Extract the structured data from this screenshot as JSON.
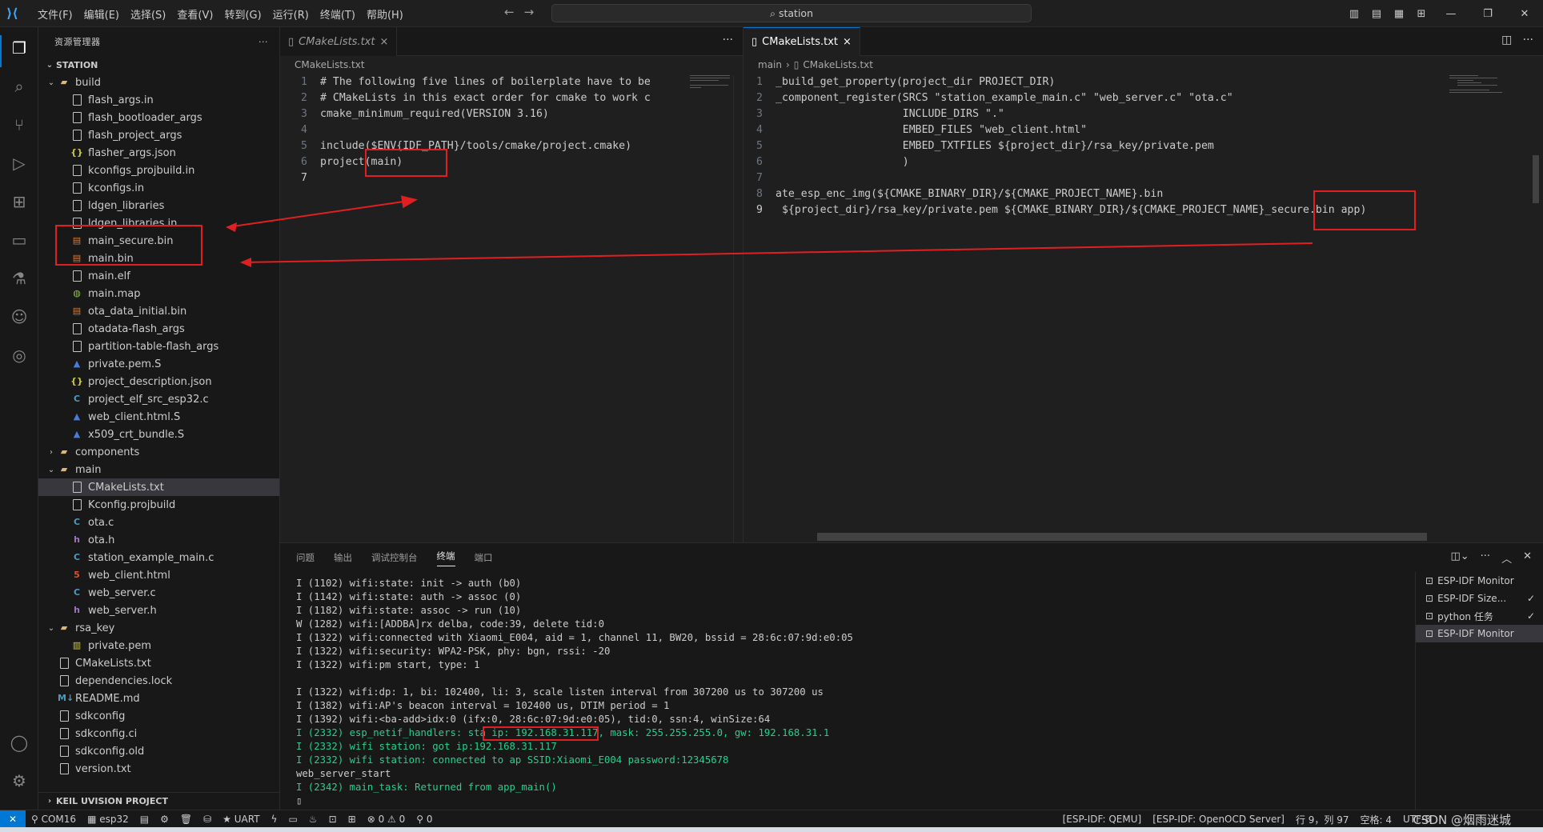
{
  "titlebar": {
    "menu": [
      "文件(F)",
      "编辑(E)",
      "选择(S)",
      "查看(V)",
      "转到(G)",
      "运行(R)",
      "终端(T)",
      "帮助(H)"
    ],
    "search": "station"
  },
  "sidebar": {
    "title": "资源管理器",
    "more": "···",
    "section": "STATION",
    "bottom_section": "KEIL UVISION PROJECT",
    "tree": [
      {
        "label": "build",
        "type": "folder-open",
        "indent": 1
      },
      {
        "label": "flash_args.in",
        "type": "file",
        "indent": 2
      },
      {
        "label": "flash_bootloader_args",
        "type": "file",
        "indent": 2
      },
      {
        "label": "flash_project_args",
        "type": "file",
        "indent": 2
      },
      {
        "label": "flasher_args.json",
        "type": "json",
        "indent": 2
      },
      {
        "label": "kconfigs_projbuild.in",
        "type": "file",
        "indent": 2
      },
      {
        "label": "kconfigs.in",
        "type": "file",
        "indent": 2
      },
      {
        "label": "ldgen_libraries",
        "type": "file",
        "indent": 2
      },
      {
        "label": "ldgen_libraries.in",
        "type": "file",
        "indent": 2
      },
      {
        "label": "main_secure.bin",
        "type": "bin",
        "indent": 2
      },
      {
        "label": "main.bin",
        "type": "bin",
        "indent": 2
      },
      {
        "label": "main.elf",
        "type": "file",
        "indent": 2
      },
      {
        "label": "main.map",
        "type": "map",
        "indent": 2
      },
      {
        "label": "ota_data_initial.bin",
        "type": "bin",
        "indent": 2
      },
      {
        "label": "otadata-flash_args",
        "type": "file",
        "indent": 2
      },
      {
        "label": "partition-table-flash_args",
        "type": "file",
        "indent": 2
      },
      {
        "label": "private.pem.S",
        "type": "s",
        "indent": 2
      },
      {
        "label": "project_description.json",
        "type": "json",
        "indent": 2
      },
      {
        "label": "project_elf_src_esp32.c",
        "type": "c",
        "indent": 2
      },
      {
        "label": "web_client.html.S",
        "type": "s",
        "indent": 2
      },
      {
        "label": "x509_crt_bundle.S",
        "type": "s",
        "indent": 2
      },
      {
        "label": "components",
        "type": "folder-closed",
        "indent": 1
      },
      {
        "label": "main",
        "type": "folder-open",
        "indent": 1
      },
      {
        "label": "CMakeLists.txt",
        "type": "file",
        "indent": 2,
        "selected": true
      },
      {
        "label": "Kconfig.projbuild",
        "type": "file",
        "indent": 2
      },
      {
        "label": "ota.c",
        "type": "c",
        "indent": 2
      },
      {
        "label": "ota.h",
        "type": "h",
        "indent": 2
      },
      {
        "label": "station_example_main.c",
        "type": "c",
        "indent": 2
      },
      {
        "label": "web_client.html",
        "type": "html",
        "indent": 2
      },
      {
        "label": "web_server.c",
        "type": "c",
        "indent": 2
      },
      {
        "label": "web_server.h",
        "type": "h",
        "indent": 2
      },
      {
        "label": "rsa_key",
        "type": "folder-open",
        "indent": 1
      },
      {
        "label": "private.pem",
        "type": "pem",
        "indent": 2
      },
      {
        "label": "CMakeLists.txt",
        "type": "file",
        "indent": 1
      },
      {
        "label": "dependencies.lock",
        "type": "file",
        "indent": 1
      },
      {
        "label": "README.md",
        "type": "md",
        "indent": 1
      },
      {
        "label": "sdkconfig",
        "type": "file",
        "indent": 1
      },
      {
        "label": "sdkconfig.ci",
        "type": "file",
        "indent": 1
      },
      {
        "label": "sdkconfig.old",
        "type": "file",
        "indent": 1
      },
      {
        "label": "version.txt",
        "type": "file",
        "indent": 1
      }
    ]
  },
  "editor_left": {
    "tab": "CMakeLists.txt",
    "tab_close": "×",
    "breadcrumb_file": "CMakeLists.txt",
    "lines": [
      {
        "n": "1",
        "text": "# The following five lines of boilerplate have to be"
      },
      {
        "n": "2",
        "text": "# CMakeLists in this exact order for cmake to work c"
      },
      {
        "n": "3",
        "text": "cmake_minimum_required(VERSION 3.16)"
      },
      {
        "n": "4",
        "text": ""
      },
      {
        "n": "5",
        "text": "include($ENV{IDF_PATH}/tools/cmake/project.cmake)"
      },
      {
        "n": "6",
        "text": "project(main)"
      },
      {
        "n": "7",
        "text": ""
      }
    ]
  },
  "editor_right": {
    "tab": "CMakeLists.txt",
    "tab_close": "×",
    "breadcrumb_folder": "main",
    "breadcrumb_file": "CMakeLists.txt",
    "lines": [
      {
        "n": "1",
        "text": "_build_get_property(project_dir PROJECT_DIR)"
      },
      {
        "n": "2",
        "text": "_component_register(SRCS \"station_example_main.c\" \"web_server.c\" \"ota.c\""
      },
      {
        "n": "3",
        "text": "                    INCLUDE_DIRS \".\""
      },
      {
        "n": "4",
        "text": "                    EMBED_FILES \"web_client.html\""
      },
      {
        "n": "5",
        "text": "                    EMBED_TXTFILES ${project_dir}/rsa_key/private.pem"
      },
      {
        "n": "6",
        "text": "                    )"
      },
      {
        "n": "7",
        "text": ""
      },
      {
        "n": "8",
        "text": "ate_esp_enc_img(${CMAKE_BINARY_DIR}/${CMAKE_PROJECT_NAME}.bin"
      },
      {
        "n": "9",
        "text": " ${project_dir}/rsa_key/private.pem ${CMAKE_BINARY_DIR}/${CMAKE_PROJECT_NAME}_secure.bin app)"
      }
    ]
  },
  "panel": {
    "tabs": [
      "问题",
      "输出",
      "调试控制台",
      "终端",
      "端口"
    ],
    "active_tab": "终端",
    "terminal_lines": [
      {
        "t": "I (1102) wifi:state: init -> auth (b0)",
        "g": false
      },
      {
        "t": "I (1142) wifi:state: auth -> assoc (0)",
        "g": false
      },
      {
        "t": "I (1182) wifi:state: assoc -> run (10)",
        "g": false
      },
      {
        "t": "W (1282) wifi:[ADDBA]rx delba, code:39, delete tid:0",
        "g": false
      },
      {
        "t": "I (1322) wifi:connected with Xiaomi_E004, aid = 1, channel 11, BW20, bssid = 28:6c:07:9d:e0:05",
        "g": false
      },
      {
        "t": "I (1322) wifi:security: WPA2-PSK, phy: bgn, rssi: -20",
        "g": false
      },
      {
        "t": "I (1322) wifi:pm start, type: 1",
        "g": false
      },
      {
        "t": "",
        "g": false
      },
      {
        "t": "I (1322) wifi:dp: 1, bi: 102400, li: 3, scale listen interval from 307200 us to 307200 us",
        "g": false
      },
      {
        "t": "I (1382) wifi:AP's beacon interval = 102400 us, DTIM period = 1",
        "g": false
      },
      {
        "t": "I (1392) wifi:<ba-add>idx:0 (ifx:0, 28:6c:07:9d:e0:05), tid:0, ssn:4, winSize:64",
        "g": false
      },
      {
        "t": "I (2332) esp_netif_handlers: sta ip: 192.168.31.117, mask: 255.255.255.0, gw: 192.168.31.1",
        "g": true
      },
      {
        "t": "I (2332) wifi station: got ip:192.168.31.117",
        "g": true
      },
      {
        "t": "I (2332) wifi station: connected to ap SSID:Xiaomi_E004 password:12345678",
        "g": true
      },
      {
        "t": "web_server_start",
        "g": false
      },
      {
        "t": "I (2342) main_task: Returned from app_main()",
        "g": true
      },
      {
        "t": "▯",
        "g": false
      }
    ],
    "terminals": [
      {
        "label": "ESP-IDF Monitor",
        "check": ""
      },
      {
        "label": "ESP-IDF Size...",
        "check": "✓"
      },
      {
        "label": "python 任务",
        "check": "✓"
      },
      {
        "label": "ESP-IDF Monitor",
        "check": "",
        "selected": true
      }
    ]
  },
  "statusbar": {
    "left": [
      "COM16",
      "esp32",
      "",
      "",
      "",
      "",
      "UART",
      "",
      "",
      "",
      "",
      "⊗ 0 ⚠ 0",
      "📶 0"
    ],
    "com": "COM16",
    "target": "esp32",
    "uart": "UART",
    "problems": "0 ⚠ 0",
    "ports": "0",
    "right": [
      "[ESP-IDF: QEMU]",
      "[ESP-IDF: OpenOCD Server]",
      "行 9，列 97",
      "空格: 4",
      "UTF-8"
    ]
  },
  "watermark": "CSDN @烟雨迷城",
  "colors": {
    "accent": "#0078d4",
    "annotation": "#e02020",
    "terminal_green": "#23d18b"
  }
}
